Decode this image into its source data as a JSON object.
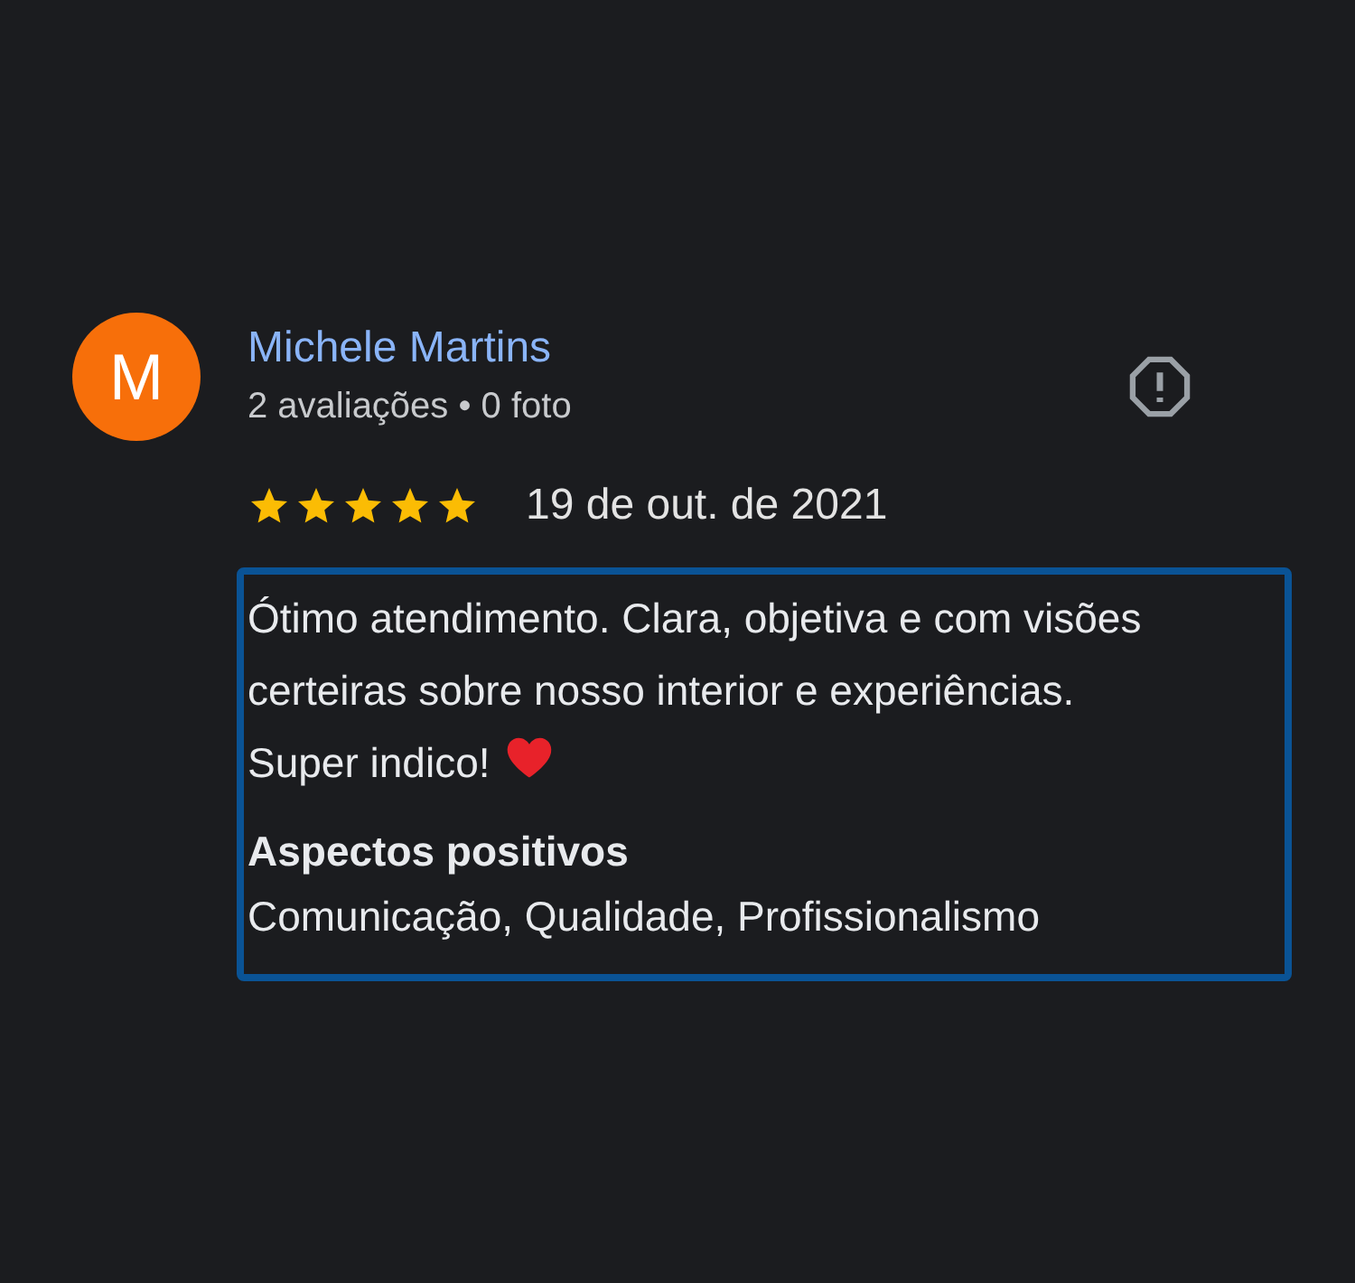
{
  "review": {
    "avatar_letter": "M",
    "author": "Michele Martins",
    "meta": "2 avaliações • 0 foto",
    "stars": 5,
    "date": "19 de out. de 2021",
    "text": "Ótimo atendimento. Clara, objetiva e com visões certeiras sobre nosso interior e experiências. Super indico!",
    "highlights_title": "Aspectos positivos",
    "highlights": "Comunicação, Qualidade, Profissionalismo"
  }
}
